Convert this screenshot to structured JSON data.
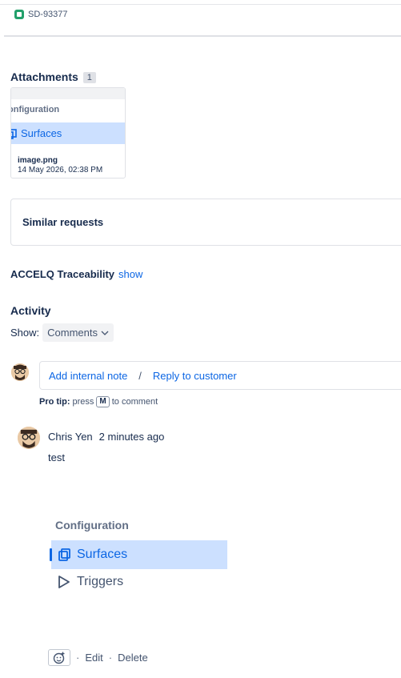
{
  "issue": {
    "key": "SD-93377"
  },
  "attachments": {
    "title": "Attachments",
    "count": "1",
    "items": [
      {
        "thumb_heading": "onfiguration",
        "thumb_item": "Surfaces",
        "file_name": "image.png",
        "date": "14 May 2026, 02:38 PM"
      }
    ]
  },
  "similar_requests": {
    "title": "Similar requests"
  },
  "accelq": {
    "title": "ACCELQ Traceability",
    "link": "show"
  },
  "activity": {
    "title": "Activity",
    "show_label": "Show:",
    "filter_value": "Comments"
  },
  "composer": {
    "internal_note": "Add internal note",
    "separator": "/",
    "reply": "Reply to customer"
  },
  "pro_tip": {
    "label": "Pro tip:",
    "text_before": "press",
    "key": "M",
    "text_after": "to comment"
  },
  "comment": {
    "author": "Chris Yen",
    "time": "2 minutes ago",
    "body": "test",
    "embed": {
      "heading": "Configuration",
      "items": [
        "Surfaces",
        "Triggers"
      ]
    },
    "actions": {
      "edit": "Edit",
      "delete": "Delete",
      "dot": "·"
    }
  },
  "colors": {
    "accent": "#0c66e4",
    "selected_bg": "#cce0ff",
    "issue_icon": "#22a06b"
  }
}
